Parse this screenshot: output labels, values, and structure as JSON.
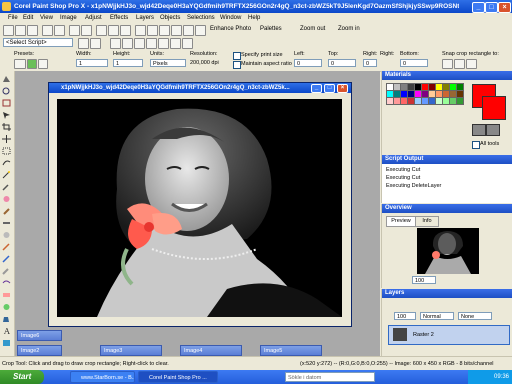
{
  "window": {
    "title": "Corel Paint Shop Pro X - x1pNWjjkHJ3o_wjd42Deqe0H3aYQGdfmih9TRFTX256GOn2r4gQ_n3ct-zbWZ5kT9J5lenKgd7OazmSfShjkjySSwp9ROSNtRtJ..."
  },
  "menu": [
    "File",
    "Edit",
    "View",
    "Image",
    "Adjust",
    "Effects",
    "Layers",
    "Objects",
    "Selections",
    "Window",
    "Help"
  ],
  "toolbar": {
    "enhance_photo": "Enhance Photo",
    "palettes": "Palettes",
    "zoom_out": "Zoom out",
    "zoom_in": "Zoom in",
    "select_script": "<Select Script>"
  },
  "options": {
    "presets_label": "Presets:",
    "width_label": "Width:",
    "width_value": "1",
    "height_label": "Height:",
    "height_value": "1",
    "units_label": "Units:",
    "units_value": "Pixels",
    "resolution_label": "Resolution:",
    "resolution_value": "200,000 dpi",
    "specify_print_size": "Specify print size",
    "maintain_aspect": "Maintain aspect ratio",
    "left_label": "Left:",
    "left_value": "0",
    "top_label": "Top:",
    "top_value": "0",
    "right_label": "Right:",
    "right_value": "0",
    "bottom_label": "Bottom:",
    "bottom_value": "0",
    "snap_label": "Snap crop rectangle to:"
  },
  "image_window": {
    "title": "x1pNWjjkHJ3o_wjd42Deqe0H3aYQGdfmih9TRFTX256GOn2r4gQ_n3ct-zbWZ5k..."
  },
  "minimized": [
    "Image6",
    "Image2",
    "Image3",
    "Image4",
    "Image5"
  ],
  "materials": {
    "title": "Materials",
    "all_tools": "All tools",
    "swatch_colors": [
      "#ffffff",
      "#c0c0c0",
      "#808080",
      "#404040",
      "#000000",
      "#ff0000",
      "#800000",
      "#ffff00",
      "#808000",
      "#00ff00",
      "#008000",
      "#00ffff",
      "#008080",
      "#0000ff",
      "#000080",
      "#ff00ff",
      "#800080",
      "#ffcc99",
      "#ff9966",
      "#cc6633",
      "#996633",
      "#663300",
      "#ffcccc",
      "#ff9999",
      "#ff6666",
      "#cc3333",
      "#99ccff",
      "#6699ff",
      "#3366cc",
      "#ccffcc",
      "#99ff99",
      "#66cc66",
      "#339933"
    ],
    "fg_color": "#ff0000",
    "bg_color": "#ff0000"
  },
  "script_output": {
    "title": "Script Output",
    "lines": [
      "Executing Cut",
      "Executing Cut",
      "Executing DeleteLayer"
    ]
  },
  "overview": {
    "title": "Overview",
    "tab_preview": "Preview",
    "tab_info": "Info",
    "zoom": "100"
  },
  "layers": {
    "title": "Layers",
    "opacity": "100",
    "blend": "Normal",
    "mask": "None",
    "layer_name": "Raster 2"
  },
  "status": {
    "text": "Crop Tool: Click and drag to draw crop rectangle; Right-click to clear.",
    "info": "(x:520 y:272) -- (R:0,G:0,B:0,O:255) -- Image: 600 x 450 x RGB - 8 bits/channel"
  },
  "taskbar": {
    "start": "Start",
    "items": [
      "www.StarBorn.se - B...",
      "Corel Paint Shop Pro ...",
      "Sökle i datom"
    ],
    "time": "09:36"
  }
}
